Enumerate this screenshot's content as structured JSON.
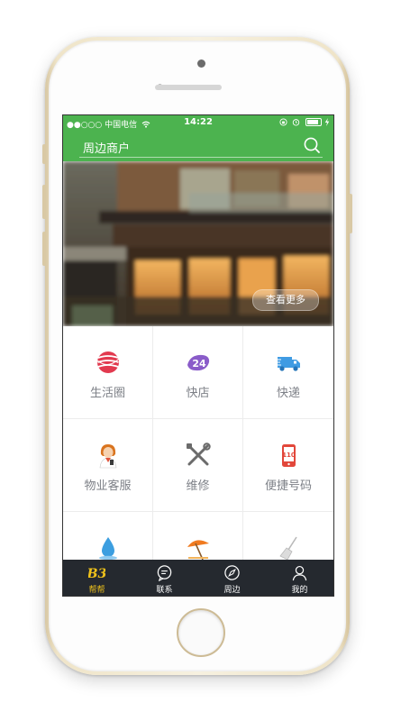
{
  "status_bar": {
    "carrier": "●●○○○ 中国电信",
    "wifi": "wifi-icon",
    "time": "14:22",
    "battery": "battery-icon"
  },
  "nav": {
    "title": "周边商户",
    "search_icon": "search-icon"
  },
  "banner": {
    "more_label": "查看更多"
  },
  "grid": {
    "items": [
      {
        "label": "生活圈",
        "icon": "life-circle-icon"
      },
      {
        "label": "快店",
        "icon": "quick-shop-24-icon"
      },
      {
        "label": "快递",
        "icon": "delivery-truck-icon"
      },
      {
        "label": "物业客服",
        "icon": "service-agent-icon"
      },
      {
        "label": "维修",
        "icon": "repair-tools-icon"
      },
      {
        "label": "便捷号码",
        "icon": "phone-110-icon"
      },
      {
        "label": "",
        "icon": "water-drop-icon"
      },
      {
        "label": "",
        "icon": "beach-umbrella-icon"
      },
      {
        "label": "",
        "icon": "broom-icon"
      }
    ]
  },
  "tab_bar": {
    "tabs": [
      {
        "label": "帮帮",
        "icon": "bb-logo-icon",
        "active": true
      },
      {
        "label": "联系",
        "icon": "chat-icon",
        "active": false
      },
      {
        "label": "周边",
        "icon": "compass-icon",
        "active": false
      },
      {
        "label": "我的",
        "icon": "user-icon",
        "active": false
      }
    ]
  },
  "colors": {
    "primary_green": "#4cb34f",
    "tab_bar_bg": "#25292f",
    "tab_active": "#f0c21b",
    "label_gray": "#7d8087"
  }
}
